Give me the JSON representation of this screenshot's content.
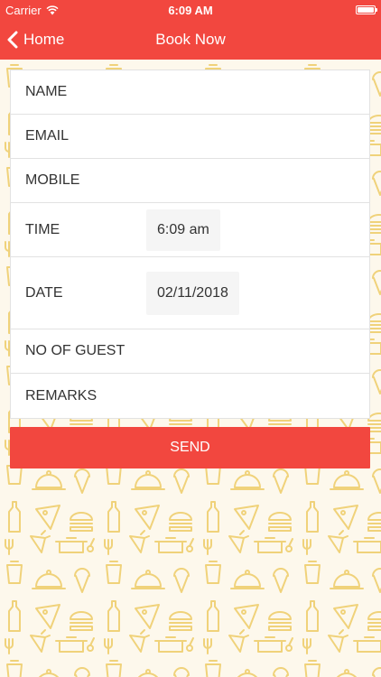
{
  "status_bar": {
    "carrier": "Carrier",
    "time": "6:09 AM"
  },
  "nav": {
    "back_label": "Home",
    "title": "Book Now"
  },
  "form": {
    "name_label": "NAME",
    "email_label": "EMAIL",
    "mobile_label": "MOBILE",
    "time_label": "TIME",
    "time_value": "6:09 am",
    "date_label": "DATE",
    "date_value": "02/11/2018",
    "guests_label": "NO OF GUEST",
    "remarks_label": "REMARKS"
  },
  "send_label": "SEND",
  "colors": {
    "accent": "#f2473f",
    "pattern": "#f0d27a",
    "background": "#fdf8ec"
  },
  "icons": [
    "wifi-icon",
    "battery-icon",
    "chevron-left-icon"
  ]
}
